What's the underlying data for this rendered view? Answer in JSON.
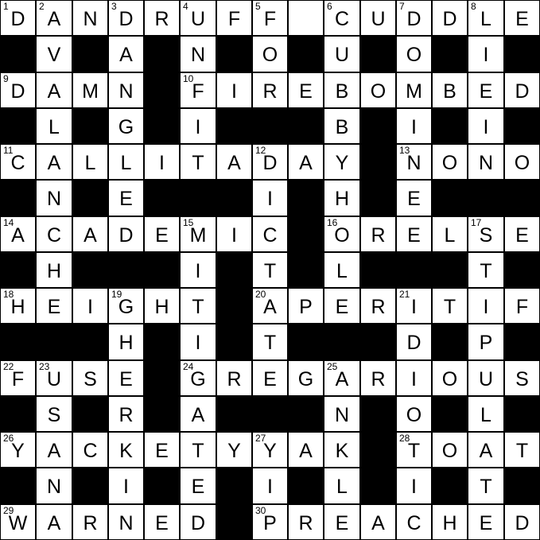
{
  "puzzle": {
    "size": 15,
    "grid": [
      "DANDRUFF.CUDDLE",
      "#V#A#N#O#U#O#I#",
      "DAMN#FIREBOMBED",
      "#L#G#I###B#I#I#",
      "CALLITADAY#NONO",
      "#N#E###I#H#E###",
      "ACADEMIC#ORELSE",
      "#H###I#T#L###T#",
      "HEIGHT#APERITIF",
      "###H#I#T###D#P#",
      "FUSE#GREGARIOUS",
      "#S#R#A###N#O#L#",
      "YACKETYYAK#TOAT",
      "#N#I#E#I#L#I#T#",
      "WARNED#PREACHED"
    ],
    "numbers": [
      {
        "n": "1",
        "r": 0,
        "c": 0
      },
      {
        "n": "2",
        "r": 0,
        "c": 1
      },
      {
        "n": "3",
        "r": 0,
        "c": 3
      },
      {
        "n": "4",
        "r": 0,
        "c": 5
      },
      {
        "n": "5",
        "r": 0,
        "c": 7
      },
      {
        "n": "6",
        "r": 0,
        "c": 9
      },
      {
        "n": "7",
        "r": 0,
        "c": 11
      },
      {
        "n": "8",
        "r": 0,
        "c": 13
      },
      {
        "n": "9",
        "r": 2,
        "c": 0
      },
      {
        "n": "10",
        "r": 2,
        "c": 5
      },
      {
        "n": "11",
        "r": 4,
        "c": 0
      },
      {
        "n": "12",
        "r": 4,
        "c": 7
      },
      {
        "n": "13",
        "r": 4,
        "c": 11
      },
      {
        "n": "14",
        "r": 6,
        "c": 0
      },
      {
        "n": "15",
        "r": 6,
        "c": 5
      },
      {
        "n": "16",
        "r": 6,
        "c": 9
      },
      {
        "n": "17",
        "r": 6,
        "c": 13
      },
      {
        "n": "18",
        "r": 8,
        "c": 0
      },
      {
        "n": "19",
        "r": 8,
        "c": 3
      },
      {
        "n": "20",
        "r": 8,
        "c": 7
      },
      {
        "n": "21",
        "r": 8,
        "c": 11
      },
      {
        "n": "22",
        "r": 10,
        "c": 0
      },
      {
        "n": "23",
        "r": 10,
        "c": 1
      },
      {
        "n": "24",
        "r": 10,
        "c": 5
      },
      {
        "n": "25",
        "r": 10,
        "c": 9
      },
      {
        "n": "26",
        "r": 12,
        "c": 0
      },
      {
        "n": "27",
        "r": 12,
        "c": 7
      },
      {
        "n": "28",
        "r": 12,
        "c": 11
      },
      {
        "n": "29",
        "r": 14,
        "c": 0
      },
      {
        "n": "30",
        "r": 14,
        "c": 7
      }
    ]
  }
}
